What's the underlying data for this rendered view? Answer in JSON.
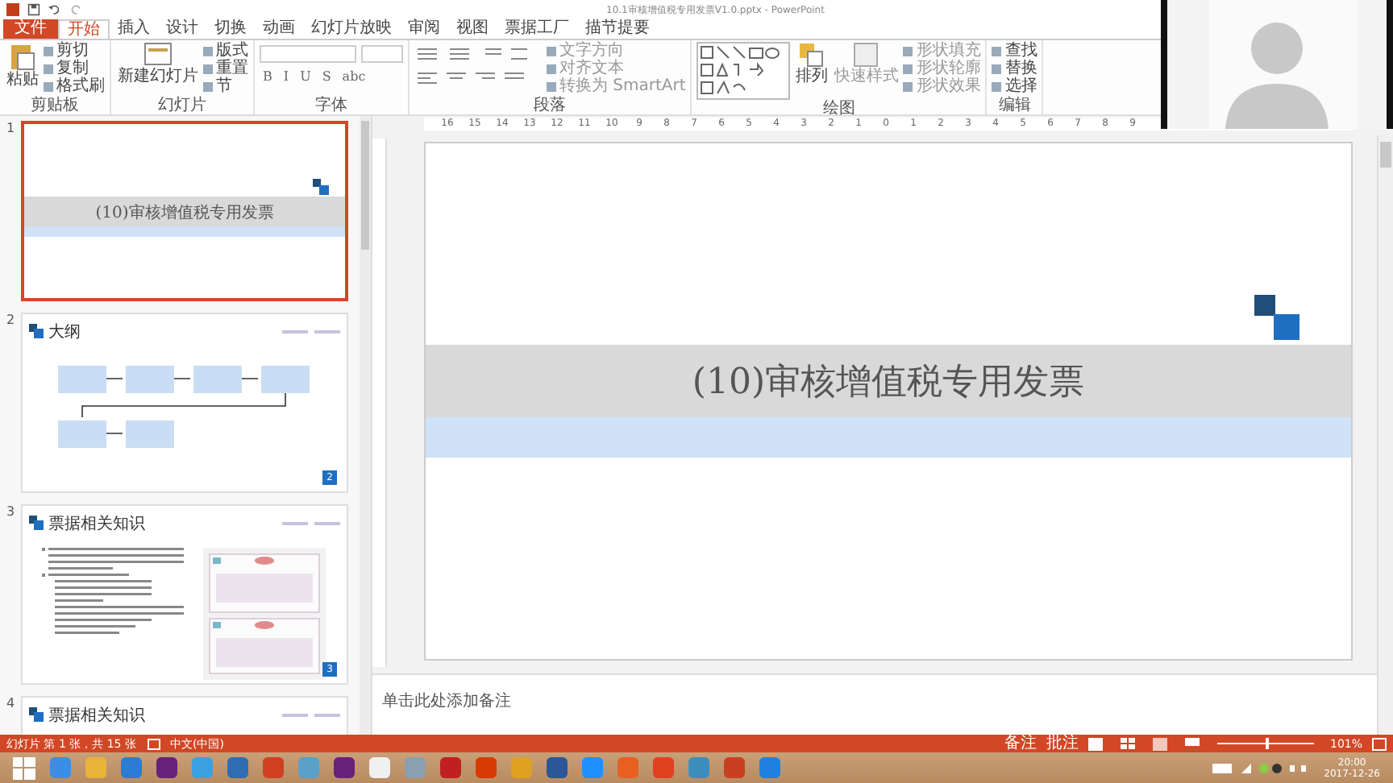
{
  "window": {
    "title": "10.1审核增值税专用发票V1.0.pptx - PowerPoint"
  },
  "tabs": [
    {
      "label": "文件",
      "kind": "file",
      "selected": false
    },
    {
      "label": "开始",
      "kind": "tab",
      "selected": true
    },
    {
      "label": "插入",
      "kind": "tab",
      "selected": false
    },
    {
      "label": "设计",
      "kind": "tab",
      "selected": false
    },
    {
      "label": "切换",
      "kind": "tab",
      "selected": false
    },
    {
      "label": "动画",
      "kind": "tab",
      "selected": false
    },
    {
      "label": "幻灯片放映",
      "kind": "tab",
      "selected": false
    },
    {
      "label": "审阅",
      "kind": "tab",
      "selected": false
    },
    {
      "label": "视图",
      "kind": "tab",
      "selected": false
    },
    {
      "label": "票据工厂",
      "kind": "tab",
      "selected": false
    },
    {
      "label": "描节提要",
      "kind": "tab",
      "selected": false
    }
  ],
  "ribbon": {
    "groups": [
      {
        "label": "剪贴板",
        "kind": "clipboard",
        "large": "粘贴",
        "small": [
          "剪切",
          "复制",
          "格式刷"
        ]
      },
      {
        "label": "幻灯片",
        "kind": "slides",
        "large": "新建幻灯片",
        "small": [
          "版式",
          "重置",
          "节"
        ]
      },
      {
        "label": "字体",
        "kind": "font",
        "format": [
          "B",
          "I",
          "U",
          "S",
          "abc"
        ]
      },
      {
        "label": "段落",
        "kind": "paragraph",
        "small": [
          "文字方向",
          "对齐文本",
          "转换为 SmartArt"
        ]
      },
      {
        "label": "绘图",
        "kind": "drawing",
        "large": "排列",
        "second": "快速样式",
        "small": [
          "形状填充",
          "形状轮廓",
          "形状效果"
        ]
      },
      {
        "label": "编辑",
        "kind": "editing",
        "small": [
          "查找",
          "替换",
          "选择"
        ]
      }
    ]
  },
  "ruler": [
    "16",
    "15",
    "14",
    "13",
    "12",
    "11",
    "10",
    "9",
    "8",
    "7",
    "6",
    "5",
    "4",
    "3",
    "2",
    "1",
    "0",
    "1",
    "2",
    "3",
    "4",
    "5",
    "6",
    "7",
    "8",
    "9"
  ],
  "slides": [
    {
      "number": "1",
      "kind": "title",
      "selected": true,
      "title": "(10)审核增值税专用发票"
    },
    {
      "number": "2",
      "kind": "flow",
      "selected": false,
      "title": "大纲",
      "page": "2"
    },
    {
      "number": "3",
      "kind": "text-image",
      "selected": false,
      "title": "票据相关知识",
      "page": "3"
    },
    {
      "number": "4",
      "kind": "partial",
      "selected": false,
      "title": "票据相关知识"
    }
  ],
  "slide": {
    "title": "(10)审核增值税专用发票"
  },
  "notes": {
    "placeholder": "单击此处添加备注"
  },
  "status_bar": {
    "slide_info": "幻灯片 第 1 张，共 15 张",
    "language": "中文(中国)",
    "notes": "备注",
    "comments": "批注",
    "zoom_slider": {
      "level": 0.5
    },
    "zoom": "101%"
  },
  "taskbar": {
    "time": "20:00",
    "date": "2017-12-26"
  }
}
